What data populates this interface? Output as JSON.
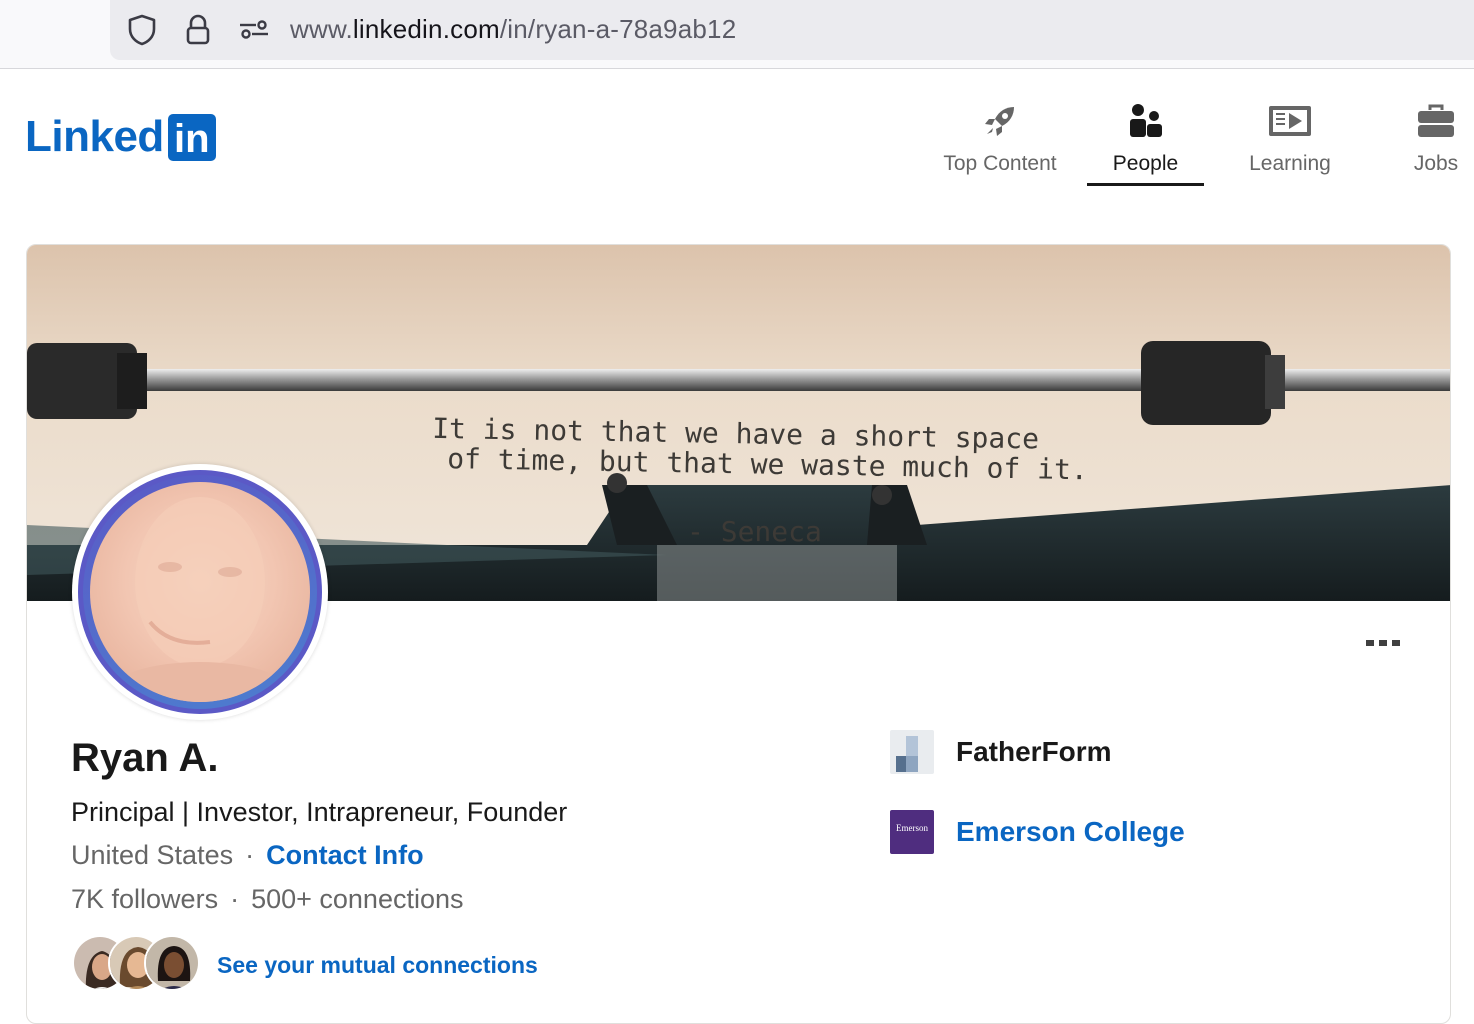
{
  "browser": {
    "url_domain_prefix": "www.",
    "url_domain": "linkedin.com",
    "url_path": "/in/ryan-a-78a9ab12",
    "icons": [
      "shield-icon",
      "lock-icon",
      "permissions-icon"
    ]
  },
  "header": {
    "logo_word": "Linked",
    "logo_box": "in",
    "nav": [
      {
        "label": "Top Content",
        "icon": "rocket-icon",
        "active": false
      },
      {
        "label": "People",
        "icon": "people-icon",
        "active": true
      },
      {
        "label": "Learning",
        "icon": "learning-icon",
        "active": false
      },
      {
        "label": "Jobs",
        "icon": "briefcase-icon",
        "active": false
      }
    ]
  },
  "banner": {
    "quote_line1": "It is not that we have a short space",
    "quote_line2": "of time, but that we waste much of it.",
    "attribution": "- Seneca"
  },
  "profile": {
    "name": "Ryan A.",
    "headline": "Principal | Investor, Intrapreneur, Founder",
    "location": "United States",
    "separator": "·",
    "contact_info": "Contact Info",
    "followers": "7K followers",
    "connections": "500+ connections",
    "mutual_connections": "See your mutual connections"
  },
  "organizations": [
    {
      "name": "FatherForm",
      "logo": "fatherform-logo",
      "is_link": false
    },
    {
      "name": "Emerson College",
      "logo": "emerson-college-logo",
      "logo_text": "Emerson",
      "is_link": true
    }
  ],
  "colors": {
    "brand": "#0a66c2",
    "text_primary": "#191919",
    "text_secondary": "#666666",
    "emerson_purple": "#4f2d7f"
  }
}
